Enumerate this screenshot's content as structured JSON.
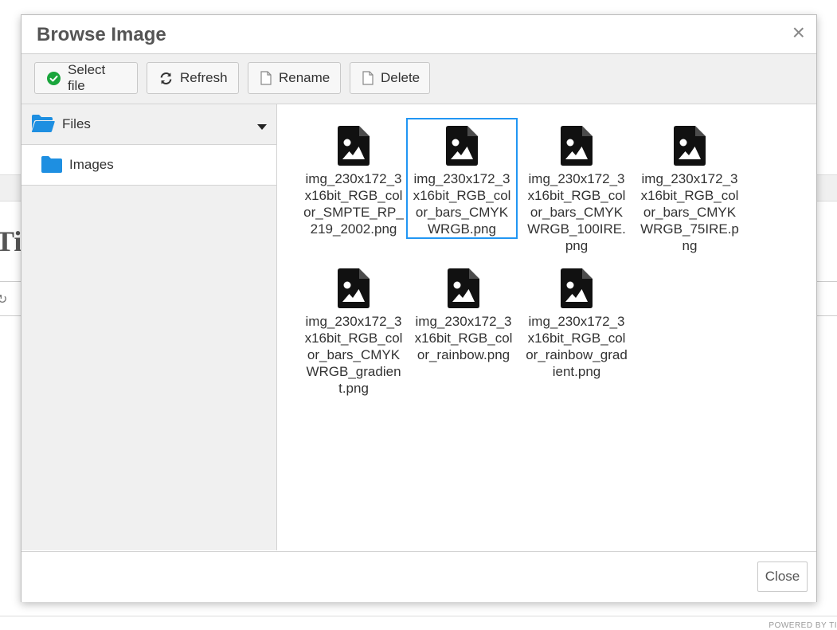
{
  "background": {
    "heading_fragment": "Ti",
    "footer_text": "POWERED BY TI"
  },
  "dialog": {
    "title": "Browse Image",
    "close_glyph": "×",
    "toolbar": {
      "select_label": "Select file",
      "refresh_label": "Refresh",
      "rename_label": "Rename",
      "delete_label": "Delete"
    },
    "sidebar": {
      "root_label": "Files",
      "folder_label": "Images"
    },
    "files": [
      {
        "name": "img_230x172_3x16bit_RGB_color_SMPTE_RP_219_2002.png",
        "selected": false
      },
      {
        "name": "img_230x172_3x16bit_RGB_color_bars_CMYKWRGB.png",
        "selected": true
      },
      {
        "name": "img_230x172_3x16bit_RGB_color_bars_CMYKWRGB_100IRE.png",
        "selected": false
      },
      {
        "name": "img_230x172_3x16bit_RGB_color_bars_CMYKWRGB_75IRE.png",
        "selected": false
      },
      {
        "name": "img_230x172_3x16bit_RGB_color_bars_CMYKWRGB_gradient.png",
        "selected": false
      },
      {
        "name": "img_230x172_3x16bit_RGB_color_rainbow.png",
        "selected": false
      },
      {
        "name": "img_230x172_3x16bit_RGB_color_rainbow_gradient.png",
        "selected": false
      }
    ],
    "footer": {
      "close_label": "Close"
    }
  },
  "colors": {
    "accent": "#2196f3",
    "success_icon": "#1aa53c",
    "folder_icon": "#1e8fe1"
  },
  "icons": {
    "select": "check-circle-icon",
    "refresh": "refresh-icon",
    "rename": "file-outline-icon",
    "delete": "file-outline-icon",
    "root": "folder-open-icon",
    "caret": "caret-down-icon",
    "folder": "folder-icon",
    "file": "image-file-icon"
  }
}
